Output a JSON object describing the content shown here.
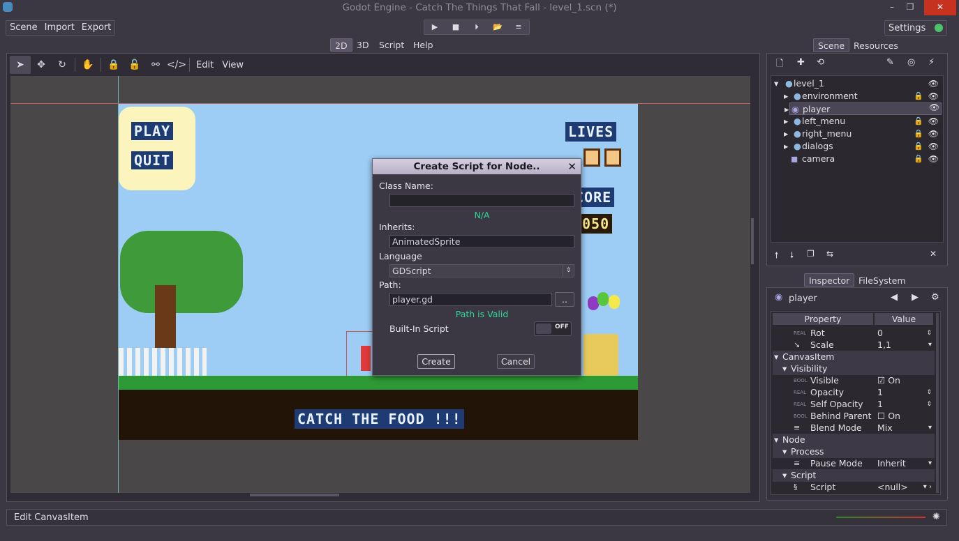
{
  "window": {
    "title": "Godot Engine - Catch The Things That Fall - level_1.scn (*)",
    "minimize": "–",
    "maximize": "❐",
    "close": "✕"
  },
  "menubar": {
    "scene": "Scene",
    "import": "Import",
    "export": "Export",
    "settings": "Settings"
  },
  "playbar": {
    "play": "▶",
    "stop": "■",
    "step": "⏵",
    "open": "📂",
    "menu": "≡"
  },
  "modes": {
    "m2d": "2D",
    "m3d": "3D",
    "script": "Script",
    "help": "Help"
  },
  "viewport_toolbar": {
    "edit": "Edit",
    "view": "View"
  },
  "game": {
    "play": "PLAY",
    "quit": "QUIT",
    "lives": "LIVES",
    "score": "CORE",
    "score_value": "050",
    "catch": "CATCH THE FOOD !!!"
  },
  "dialog": {
    "title": "Create Script for Node..",
    "close": "✕",
    "class_name_label": "Class Name:",
    "class_name_value": "",
    "class_name_status": "N/A",
    "inherits_label": "Inherits:",
    "inherits_value": "AnimatedSprite",
    "language_label": "Language",
    "language_value": "GDScript",
    "path_label": "Path:",
    "path_value": "player.gd",
    "browse": "..",
    "path_status": "Path is Valid",
    "builtin_label": "Built-In Script",
    "builtin_toggle": "OFF",
    "create": "Create",
    "cancel": "Cancel"
  },
  "scene_dock": {
    "tabs": [
      "Scene",
      "Resources"
    ],
    "nodes": [
      {
        "name": "level_1",
        "locked": false
      },
      {
        "name": "environment",
        "locked": true
      },
      {
        "name": "player",
        "locked": false
      },
      {
        "name": "left_menu",
        "locked": true
      },
      {
        "name": "right_menu",
        "locked": true
      },
      {
        "name": "dialogs",
        "locked": true
      },
      {
        "name": "camera",
        "locked": true
      }
    ]
  },
  "inspector": {
    "tabs": [
      "Inspector",
      "FileSystem"
    ],
    "object": "player",
    "header": {
      "property": "Property",
      "value": "Value"
    },
    "rows": [
      {
        "name": "Rot",
        "value": "0",
        "kind": "prop"
      },
      {
        "name": "Scale",
        "value": "1,1",
        "kind": "prop"
      },
      {
        "name": "CanvasItem",
        "value": "",
        "kind": "section"
      },
      {
        "name": "Visibility",
        "value": "",
        "kind": "subsection"
      },
      {
        "name": "Visible",
        "value": "On",
        "kind": "prop"
      },
      {
        "name": "Opacity",
        "value": "1",
        "kind": "prop"
      },
      {
        "name": "Self Opacity",
        "value": "1",
        "kind": "prop"
      },
      {
        "name": "Behind Parent",
        "value": "On",
        "kind": "prop"
      },
      {
        "name": "Blend Mode",
        "value": "Mix",
        "kind": "prop"
      },
      {
        "name": "Node",
        "value": "",
        "kind": "section"
      },
      {
        "name": "Process",
        "value": "",
        "kind": "subsection"
      },
      {
        "name": "Pause Mode",
        "value": "Inherit",
        "kind": "prop"
      },
      {
        "name": "Script",
        "value": "",
        "kind": "subsection"
      },
      {
        "name": "Script",
        "value": "<null>",
        "kind": "prop"
      }
    ]
  },
  "status": {
    "text": "Edit CanvasItem"
  }
}
